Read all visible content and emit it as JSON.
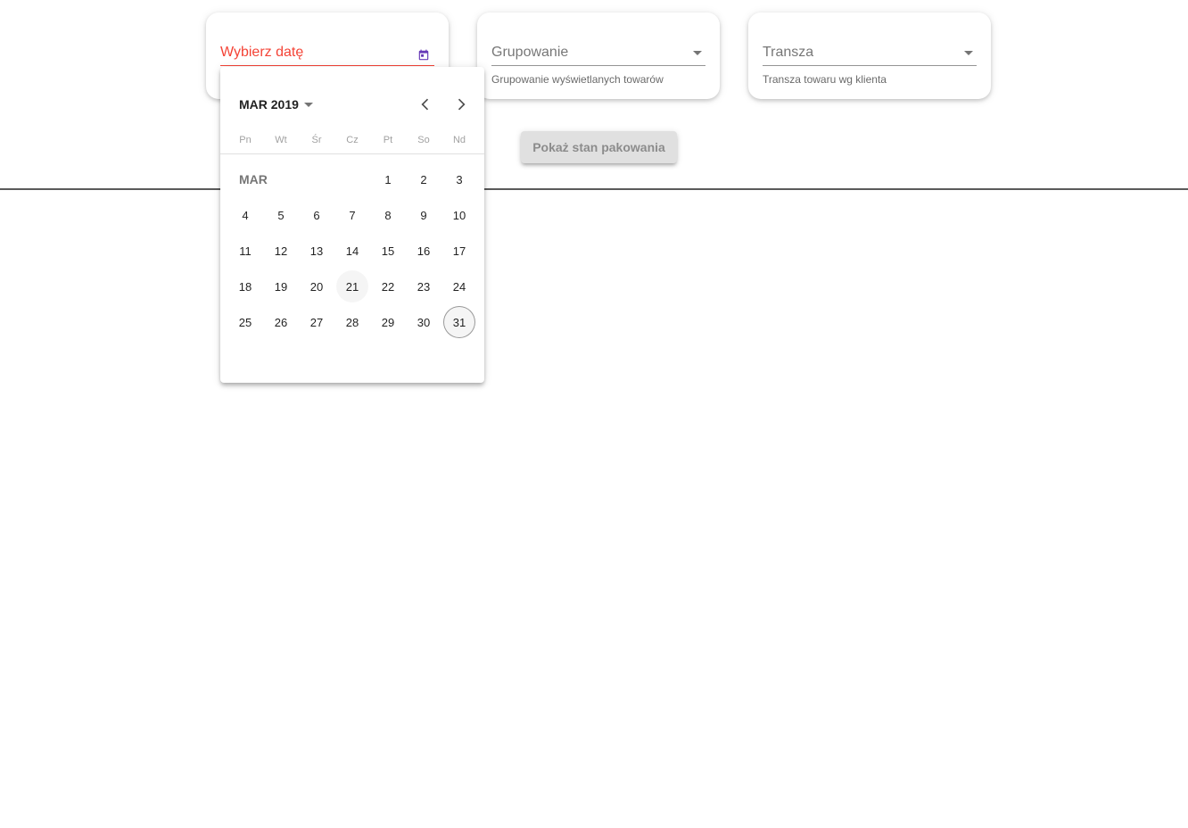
{
  "colors": {
    "error": "#f44336",
    "accent": "#673ab7",
    "button_bg": "#e0e0e0"
  },
  "date_field": {
    "label": "Wybierz datę",
    "icon": "calendar-icon"
  },
  "grouping_field": {
    "label": "Grupowanie",
    "hint": "Grupowanie wyświetlanych towarów",
    "icon": "dropdown-arrow-icon"
  },
  "tranche_field": {
    "label": "Transza",
    "hint": "Transza towaru wg klienta",
    "icon": "dropdown-arrow-icon"
  },
  "action_button": {
    "label": "Pokaż stan pakowania",
    "disabled": true
  },
  "datepicker": {
    "period_label": "MAR 2019",
    "month_label": "MAR",
    "weekdays": [
      "Pn",
      "Wt",
      "Śr",
      "Cz",
      "Pt",
      "So",
      "Nd"
    ],
    "days": [
      "1",
      "2",
      "3",
      "4",
      "5",
      "6",
      "7",
      "8",
      "9",
      "10",
      "11",
      "12",
      "13",
      "14",
      "15",
      "16",
      "17",
      "18",
      "19",
      "20",
      "21",
      "22",
      "23",
      "24",
      "25",
      "26",
      "27",
      "28",
      "29",
      "30",
      "31"
    ],
    "first_weekday_index": 4,
    "highlighted_day": "21",
    "today_day": "31",
    "prev_icon": "chevron-left-icon",
    "next_icon": "chevron-right-icon"
  }
}
